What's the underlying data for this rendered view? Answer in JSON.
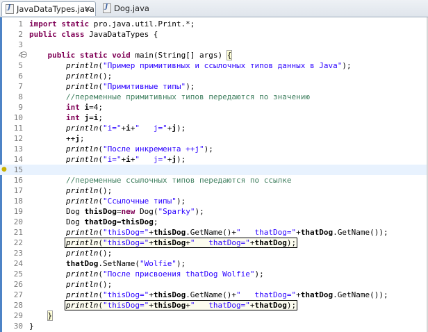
{
  "tabs": [
    {
      "label": "JavaDataTypes.java",
      "close": "✕"
    },
    {
      "label": "Dog.java"
    }
  ],
  "editor": {
    "lines": [
      {
        "n": "1",
        "tokens": [
          [
            "kw",
            "import static"
          ],
          [
            "",
            "pro.java.util.Print.*;"
          ]
        ]
      },
      {
        "n": "2",
        "tokens": [
          [
            "kw",
            "public class"
          ],
          [
            "",
            "JavaDataTypes {"
          ]
        ]
      },
      {
        "n": "3",
        "tokens": []
      },
      {
        "n": "4",
        "tokens": [
          [
            "",
            "    "
          ],
          [
            "kw",
            "public static void"
          ],
          [
            "",
            "main(String[] args) "
          ],
          [
            "bh",
            "{"
          ]
        ]
      },
      {
        "n": "5",
        "tokens": [
          [
            "",
            "        "
          ],
          [
            "mt",
            "println"
          ],
          [
            "",
            "("
          ],
          [
            "str",
            "\"Пример примитивных и ссылочных типов данных в Java\""
          ],
          [
            "",
            ");"
          ]
        ]
      },
      {
        "n": "6",
        "tokens": [
          [
            "",
            "        "
          ],
          [
            "mt",
            "println"
          ],
          [
            "",
            "();"
          ]
        ]
      },
      {
        "n": "7",
        "tokens": [
          [
            "",
            "        "
          ],
          [
            "mt",
            "println"
          ],
          [
            "",
            "("
          ],
          [
            "str",
            "\"Примитивные типы\""
          ],
          [
            "",
            ");"
          ]
        ]
      },
      {
        "n": "8",
        "tokens": [
          [
            "",
            "        "
          ],
          [
            "cmt",
            "//переменные примитивных типов передаются по значению"
          ]
        ]
      },
      {
        "n": "9",
        "tokens": [
          [
            "",
            "        "
          ],
          [
            "kw",
            "int"
          ],
          [
            "",
            ""
          ],
          [
            "var",
            "i"
          ],
          [
            "",
            "=4;"
          ]
        ]
      },
      {
        "n": "10",
        "tokens": [
          [
            "",
            "        "
          ],
          [
            "kw",
            "int"
          ],
          [
            "",
            ""
          ],
          [
            "var",
            "j"
          ],
          [
            "",
            "="
          ],
          [
            "var",
            "i"
          ],
          [
            "",
            ";"
          ]
        ]
      },
      {
        "n": "11",
        "tokens": [
          [
            "",
            "        "
          ],
          [
            "mt",
            "println"
          ],
          [
            "",
            "("
          ],
          [
            "str",
            "\"i=\""
          ],
          [
            "",
            "+"
          ],
          [
            "var",
            "i"
          ],
          [
            "",
            "+"
          ],
          [
            "str",
            "\"   j=\""
          ],
          [
            "",
            "+"
          ],
          [
            "var",
            "j"
          ],
          [
            "",
            ");"
          ]
        ]
      },
      {
        "n": "12",
        "tokens": [
          [
            "",
            "        ++"
          ],
          [
            "var",
            "j"
          ],
          [
            "",
            ";"
          ]
        ]
      },
      {
        "n": "13",
        "tokens": [
          [
            "",
            "        "
          ],
          [
            "mt",
            "println"
          ],
          [
            "",
            "("
          ],
          [
            "str",
            "\"После инкремента ++j\""
          ],
          [
            "",
            ");"
          ]
        ]
      },
      {
        "n": "14",
        "tokens": [
          [
            "",
            "        "
          ],
          [
            "mt",
            "println"
          ],
          [
            "",
            "("
          ],
          [
            "str",
            "\"i=\""
          ],
          [
            "",
            "+"
          ],
          [
            "var",
            "i"
          ],
          [
            "",
            "+"
          ],
          [
            "str",
            "\"   j=\""
          ],
          [
            "",
            "+"
          ],
          [
            "var",
            "j"
          ],
          [
            "",
            ");"
          ]
        ]
      },
      {
        "n": "15",
        "tokens": [
          [
            "",
            "        "
          ]
        ]
      },
      {
        "n": "16",
        "tokens": [
          [
            "",
            "        "
          ],
          [
            "cmt",
            "//переменные ссылочных типов передаются по ссылке"
          ]
        ]
      },
      {
        "n": "17",
        "tokens": [
          [
            "",
            "        "
          ],
          [
            "mt",
            "println"
          ],
          [
            "",
            "();"
          ]
        ]
      },
      {
        "n": "18",
        "tokens": [
          [
            "",
            "        "
          ],
          [
            "mt",
            "println"
          ],
          [
            "",
            "("
          ],
          [
            "str",
            "\"Ссылочные типы\""
          ],
          [
            "",
            ");"
          ]
        ]
      },
      {
        "n": "19",
        "tokens": [
          [
            "",
            "        Dog "
          ],
          [
            "var",
            "thisDog"
          ],
          [
            "",
            "="
          ],
          [
            "kw",
            "new"
          ],
          [
            "",
            "Dog("
          ],
          [
            "str",
            "\"Sparky\""
          ],
          [
            "",
            ");"
          ]
        ]
      },
      {
        "n": "20",
        "tokens": [
          [
            "",
            "        Dog "
          ],
          [
            "var",
            "thatDog"
          ],
          [
            "",
            "="
          ],
          [
            "var",
            "thisDog"
          ],
          [
            "",
            ";"
          ]
        ]
      },
      {
        "n": "21",
        "tokens": [
          [
            "",
            "        "
          ],
          [
            "mt",
            "println"
          ],
          [
            "",
            "("
          ],
          [
            "str",
            "\"thisDog=\""
          ],
          [
            "",
            "+"
          ],
          [
            "var",
            "thisDog"
          ],
          [
            "",
            ".GetName()+"
          ],
          [
            "str",
            "\"   thatDog=\""
          ],
          [
            "",
            "+"
          ],
          [
            "var",
            "thatDog"
          ],
          [
            "",
            ".GetName());"
          ]
        ]
      },
      {
        "n": "22",
        "tokens": [
          [
            "",
            "        "
          ],
          [
            "mt",
            "println"
          ],
          [
            "",
            "("
          ],
          [
            "str",
            "\"thisDog=\""
          ],
          [
            "",
            "+"
          ],
          [
            "var",
            "thisDog"
          ],
          [
            "",
            "+"
          ],
          [
            "str",
            "\"   thatDog=\""
          ],
          [
            "",
            "+"
          ],
          [
            "var",
            "thatDog"
          ],
          [
            "",
            ");"
          ]
        ]
      },
      {
        "n": "23",
        "tokens": [
          [
            "",
            "        "
          ],
          [
            "mt",
            "println"
          ],
          [
            "",
            "();"
          ]
        ]
      },
      {
        "n": "24",
        "tokens": [
          [
            "",
            "        "
          ],
          [
            "var",
            "thatDog"
          ],
          [
            "",
            ".SetName("
          ],
          [
            "str",
            "\"Wolfie\""
          ],
          [
            "",
            ");"
          ]
        ]
      },
      {
        "n": "25",
        "tokens": [
          [
            "",
            "        "
          ],
          [
            "mt",
            "println"
          ],
          [
            "",
            "("
          ],
          [
            "str",
            "\"После присвоения thatDog Wolfie\""
          ],
          [
            "",
            ");"
          ]
        ]
      },
      {
        "n": "26",
        "tokens": [
          [
            "",
            "        "
          ],
          [
            "mt",
            "println"
          ],
          [
            "",
            "();"
          ]
        ]
      },
      {
        "n": "27",
        "tokens": [
          [
            "",
            "        "
          ],
          [
            "mt",
            "println"
          ],
          [
            "",
            "("
          ],
          [
            "str",
            "\"thisDog=\""
          ],
          [
            "",
            "+"
          ],
          [
            "var",
            "thisDog"
          ],
          [
            "",
            ".GetName()+"
          ],
          [
            "str",
            "\"   thatDog=\""
          ],
          [
            "",
            "+"
          ],
          [
            "var",
            "thatDog"
          ],
          [
            "",
            ".GetName());"
          ]
        ]
      },
      {
        "n": "28",
        "tokens": [
          [
            "",
            "        "
          ],
          [
            "mt",
            "println"
          ],
          [
            "",
            "("
          ],
          [
            "str",
            "\"thisDog=\""
          ],
          [
            "",
            "+"
          ],
          [
            "var",
            "thisDog"
          ],
          [
            "",
            "+"
          ],
          [
            "str",
            "\"   thatDog=\""
          ],
          [
            "",
            "+"
          ],
          [
            "var",
            "thatDog"
          ],
          [
            "",
            ");"
          ]
        ]
      },
      {
        "n": "29",
        "tokens": [
          [
            "",
            "    "
          ],
          [
            "bh",
            "}"
          ]
        ]
      },
      {
        "n": "30",
        "tokens": [
          [
            "",
            "}"
          ]
        ]
      }
    ],
    "highlighted_lines": [
      "22",
      "28"
    ],
    "current_line": "15",
    "fold_line": "4",
    "fold_glyph": "⊖",
    "bulb_line": "15",
    "bulb_glyph": "💡"
  },
  "colors": {
    "keyword": "#7f0055",
    "string": "#2a00ff",
    "comment": "#3f7f5f",
    "line_number": "#787878",
    "current_line_bg": "#e8f2fe",
    "change_bar": "#4d83c6"
  }
}
